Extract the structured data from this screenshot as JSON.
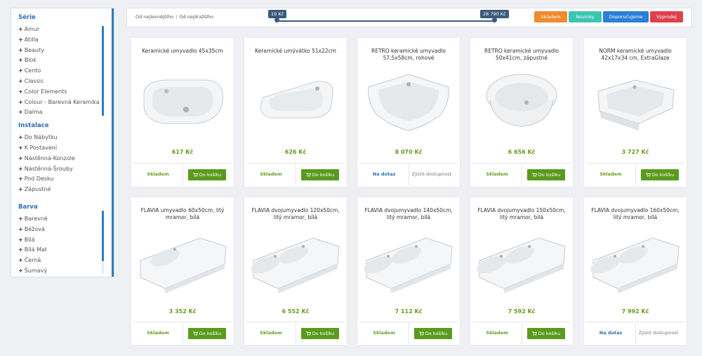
{
  "sidebar": {
    "groups": [
      {
        "title": "Série",
        "items": [
          "Amur",
          "Atilla",
          "Beauty",
          "Blok",
          "Cento",
          "Classic",
          "Color Elements",
          "Colour - Barevná Keramika",
          "Dalma"
        ]
      },
      {
        "title": "Instalace",
        "items": [
          "Do Nábytku",
          "K Postavení",
          "Nástěnná-Konzole",
          "Nástěnná-Šrouby",
          "Pod Desku",
          "Zápustné"
        ]
      },
      {
        "title": "Barva",
        "items": [
          "Barevné",
          "Béžová",
          "Bílá",
          "Bílá Mat",
          "Černá",
          "Šumavý"
        ]
      }
    ]
  },
  "topbar": {
    "sort_cheapest": "Od nejlevnějšího",
    "sort_expensive": "Od nejdražšího",
    "price_min": "19 Kč",
    "price_max": "28 790 Kč",
    "filters": [
      {
        "label": "Skladem",
        "color": "#ef8a2e"
      },
      {
        "label": "Novinky",
        "color": "#3fc3b3"
      },
      {
        "label": "Doporučujeme",
        "color": "#2a7fd6"
      },
      {
        "label": "Výprodej",
        "color": "#e0404e"
      }
    ]
  },
  "foot_labels": {
    "in_stock": "Skladem",
    "on_request": "Na dotaz",
    "add_to_cart": "Do košíku",
    "check_availability": "Zjistit dostupnost",
    "cart_icon": "cart-icon"
  },
  "products": [
    {
      "title": "Keramické umyvadlo 45x35cm",
      "price": "617 Kč",
      "stock": "in"
    },
    {
      "title": "Keramické umývátko 51x22cm",
      "price": "626 Kč",
      "stock": "in"
    },
    {
      "title": "RETRO keramické umyvadlo 57,5x58cm, rohové",
      "price": "8 070 Kč",
      "stock": "ask"
    },
    {
      "title": "RETRO keramické umyvadlo 50x41cm, zápustné",
      "price": "6 656 Kč",
      "stock": "in"
    },
    {
      "title": "NORM keramické umyvadlo 42x17x34 cm, ExtraGlaze",
      "price": "3 727 Kč",
      "stock": "in"
    },
    {
      "title": "FLAVIA umyvadlo 60x50cm, litý mramor, bílá",
      "price": "3 352 Kč",
      "stock": "in"
    },
    {
      "title": "FLAVIA dvojumyvadlo 120x50cm, litý mramor, bílá",
      "price": "6 552 Kč",
      "stock": "in"
    },
    {
      "title": "FLAVIA dvojumyvadlo 140x50cm, litý mramor, bílá",
      "price": "7 112 Kč",
      "stock": "in"
    },
    {
      "title": "FLAVIA dvojumyvadlo 150x50cm, litý mramor, bílá",
      "price": "7 592 Kč",
      "stock": "in"
    },
    {
      "title": "FLAVIA dvojumyvadlo 160x50cm, litý mramor, bílá",
      "price": "7 992 Kč",
      "stock": "ask"
    }
  ]
}
